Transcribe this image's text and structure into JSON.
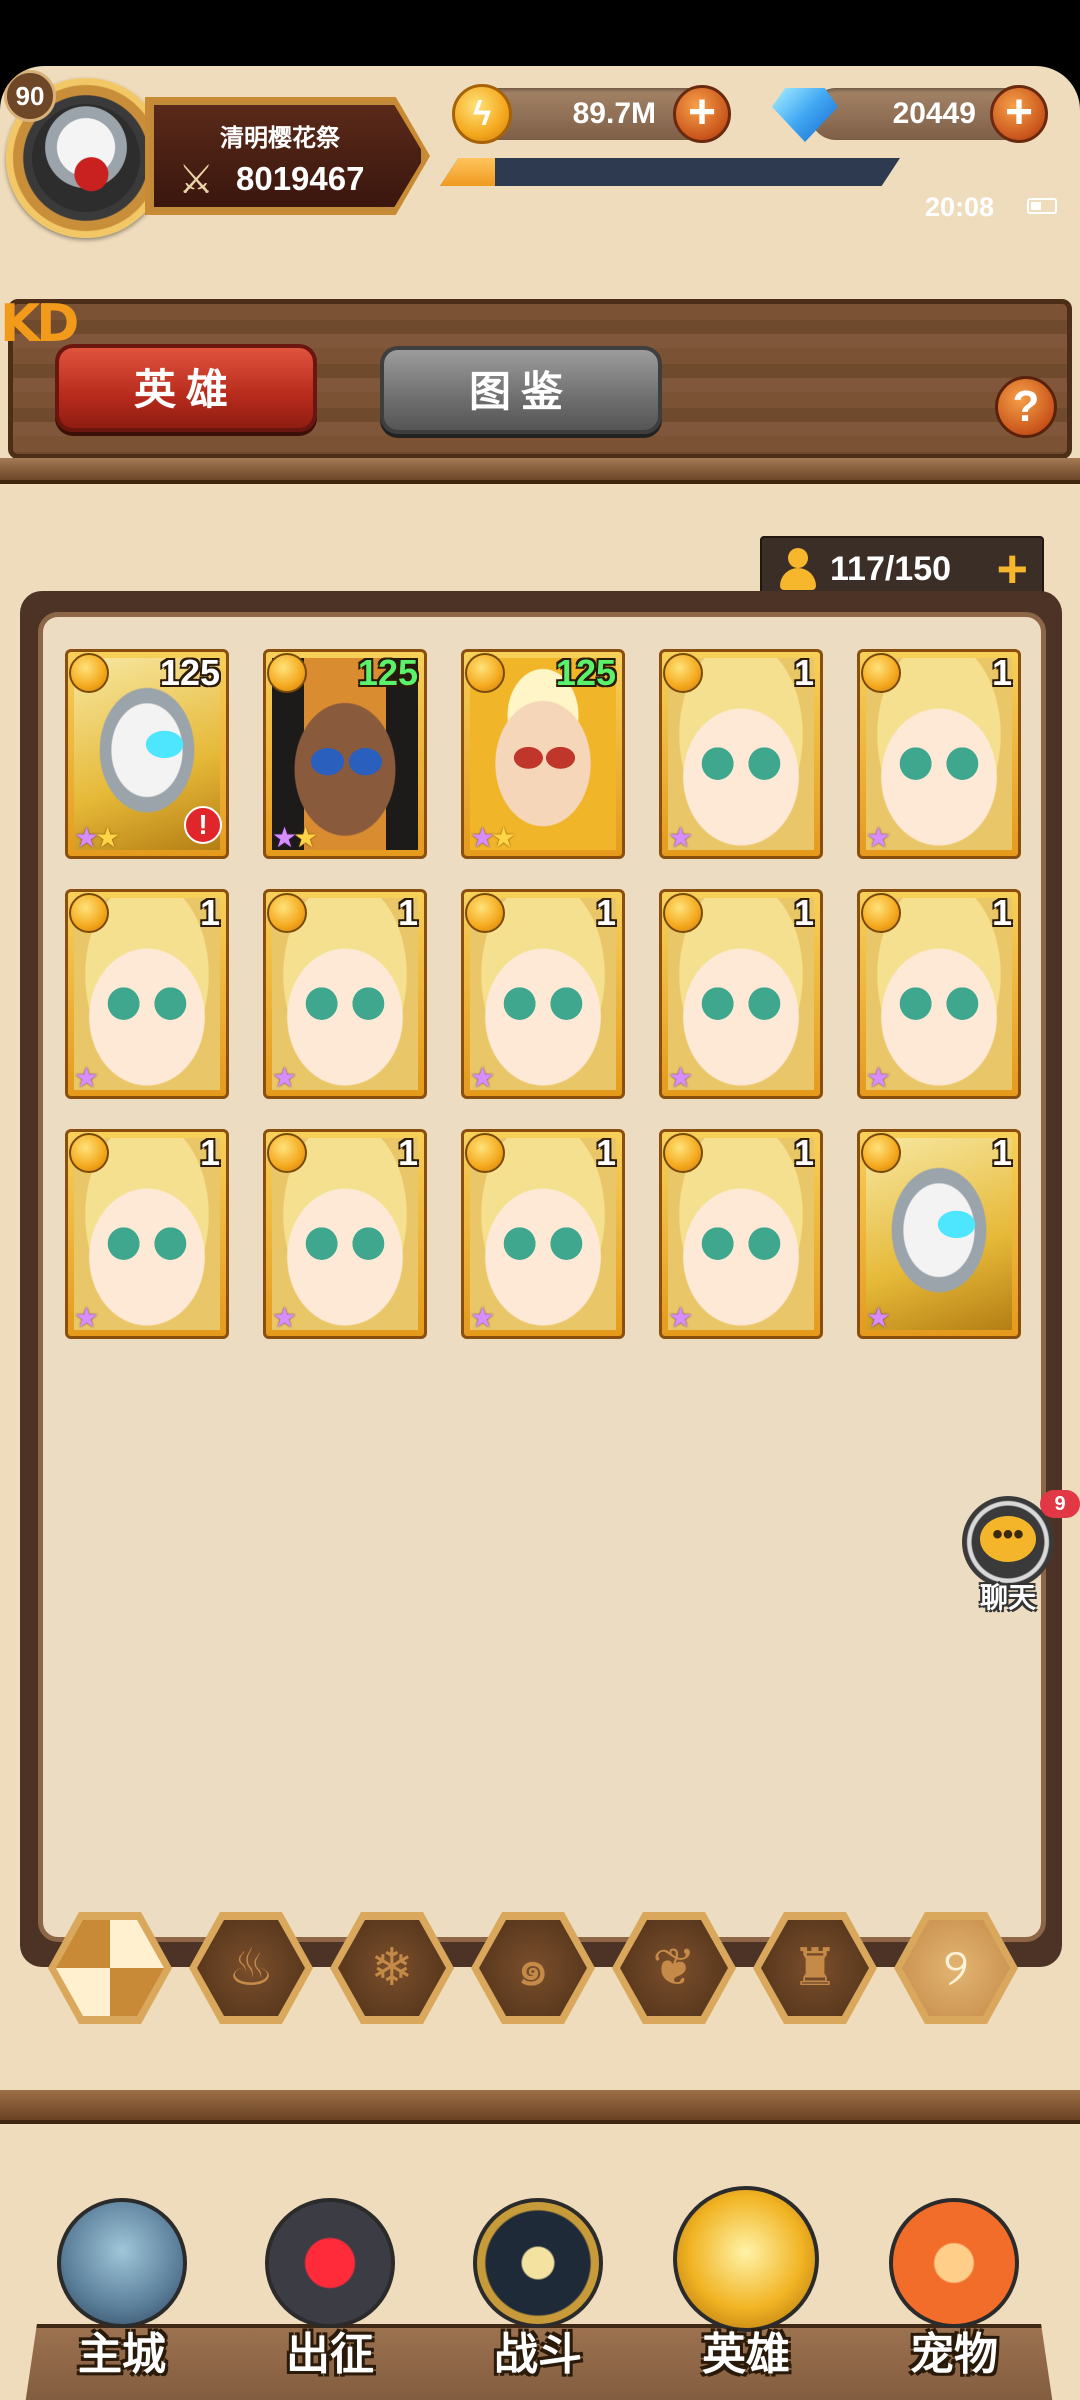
{
  "player": {
    "level": "90",
    "name": "清明樱花祭",
    "power": "8019467"
  },
  "resources": {
    "gold": "89.7M",
    "gems": "20449",
    "xp_progress": 0.12
  },
  "status": {
    "time": "20:08"
  },
  "deco_text": "KD",
  "tabs": [
    {
      "label": "英雄",
      "active": true
    },
    {
      "label": "图鉴",
      "active": false
    }
  ],
  "help_label": "?",
  "hero_capacity": "117/150",
  "heroes": [
    {
      "art": "robot",
      "level": "125",
      "level_color": "white",
      "stars_purple": 1,
      "stars_gold": 1,
      "alert": true
    },
    {
      "art": "pharaoh",
      "level": "125",
      "level_color": "green",
      "stars_purple": 1,
      "stars_gold": 1,
      "alert": false
    },
    {
      "art": "warrior",
      "level": "125",
      "level_color": "green",
      "stars_purple": 1,
      "stars_gold": 1,
      "alert": false
    },
    {
      "art": "blonde",
      "level": "1",
      "level_color": "white",
      "stars_purple": 1,
      "stars_gold": 0,
      "alert": false
    },
    {
      "art": "blonde",
      "level": "1",
      "level_color": "white",
      "stars_purple": 1,
      "stars_gold": 0,
      "alert": false
    },
    {
      "art": "blonde",
      "level": "1",
      "level_color": "white",
      "stars_purple": 1,
      "stars_gold": 0,
      "alert": false
    },
    {
      "art": "blonde",
      "level": "1",
      "level_color": "white",
      "stars_purple": 1,
      "stars_gold": 0,
      "alert": false
    },
    {
      "art": "blonde",
      "level": "1",
      "level_color": "white",
      "stars_purple": 1,
      "stars_gold": 0,
      "alert": false
    },
    {
      "art": "blonde",
      "level": "1",
      "level_color": "white",
      "stars_purple": 1,
      "stars_gold": 0,
      "alert": false
    },
    {
      "art": "blonde",
      "level": "1",
      "level_color": "white",
      "stars_purple": 1,
      "stars_gold": 0,
      "alert": false
    },
    {
      "art": "blonde",
      "level": "1",
      "level_color": "white",
      "stars_purple": 1,
      "stars_gold": 0,
      "alert": false
    },
    {
      "art": "blonde",
      "level": "1",
      "level_color": "white",
      "stars_purple": 1,
      "stars_gold": 0,
      "alert": false
    },
    {
      "art": "blonde",
      "level": "1",
      "level_color": "white",
      "stars_purple": 1,
      "stars_gold": 0,
      "alert": false
    },
    {
      "art": "blonde",
      "level": "1",
      "level_color": "white",
      "stars_purple": 1,
      "stars_gold": 0,
      "alert": false
    },
    {
      "art": "robot",
      "level": "1",
      "level_color": "white",
      "stars_purple": 1,
      "stars_gold": 0,
      "alert": false
    }
  ],
  "chat": {
    "label": "聊天",
    "badge": "9"
  },
  "element_filters": [
    {
      "name": "all-filter-icon",
      "glyph": ""
    },
    {
      "name": "fire-filter-icon",
      "glyph": "♨"
    },
    {
      "name": "ice-filter-icon",
      "glyph": "❄"
    },
    {
      "name": "wind-filter-icon",
      "glyph": "๑"
    },
    {
      "name": "nature-filter-icon",
      "glyph": "❦"
    },
    {
      "name": "dark-filter-icon",
      "glyph": "♜"
    },
    {
      "name": "light-filter-icon",
      "glyph": "୨"
    }
  ],
  "nav": [
    {
      "key": "castle",
      "label": "主城"
    },
    {
      "key": "expedition",
      "label": "出征"
    },
    {
      "key": "battle",
      "label": "战斗"
    },
    {
      "key": "heroes",
      "label": "英雄"
    },
    {
      "key": "pets",
      "label": "宠物"
    }
  ]
}
